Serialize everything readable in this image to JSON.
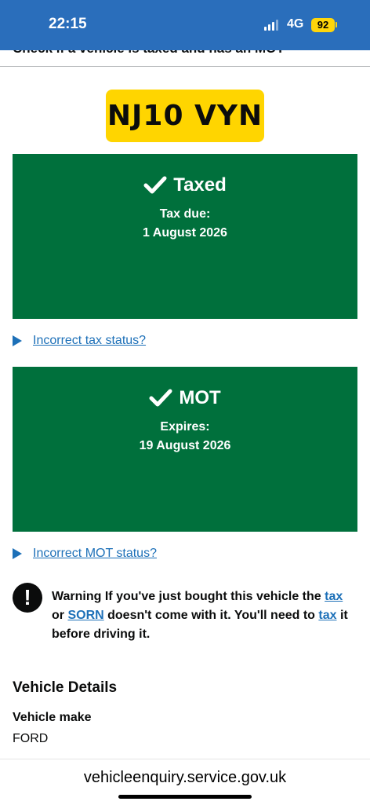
{
  "status_bar": {
    "time": "22:15",
    "network": "4G",
    "battery": "92"
  },
  "header": {
    "partial_title": "Check if a vehicle is taxed and has an MOT"
  },
  "vehicle": {
    "registration": "NJ10 VYN"
  },
  "tax_panel": {
    "title": "Taxed",
    "label": "Tax due:",
    "value": "1 August 2026"
  },
  "tax_link": "Incorrect tax status?",
  "mot_panel": {
    "title": "MOT",
    "label": "Expires:",
    "value": "19 August 2026"
  },
  "mot_link": "Incorrect MOT status?",
  "warning": {
    "part1": "Warning If you've just bought this vehicle the ",
    "link_tax_1": "tax",
    "part2": " or ",
    "link_sorn": "SORN",
    "part3": " doesn't come with it. You'll need to ",
    "link_tax_2": "tax",
    "part4": " it before driving it."
  },
  "details": {
    "heading": "Vehicle Details",
    "make_label": "Vehicle make",
    "make_value": "FORD"
  },
  "browser": {
    "url": "vehicleenquiry.service.gov.uk"
  },
  "colors": {
    "status_bar": "#2a6ebb",
    "plate": "#ffd500",
    "panel_green": "#00703c",
    "link_blue": "#1d70b8"
  }
}
